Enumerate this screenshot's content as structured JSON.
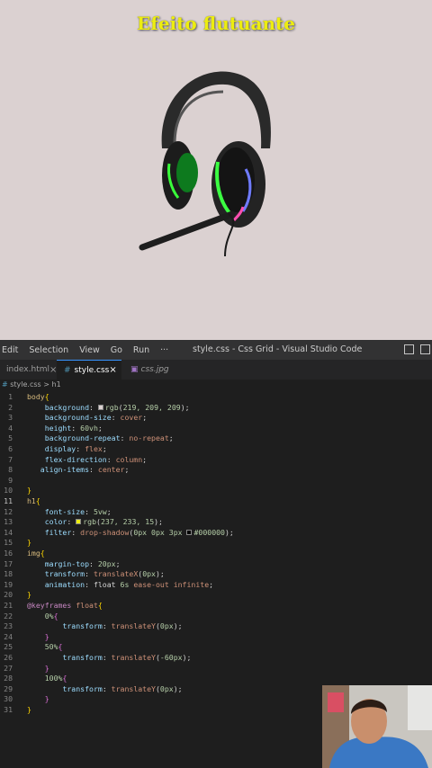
{
  "preview": {
    "title": "Efeito flutuante",
    "background": "#dbd1d1",
    "title_color": "#eded0f"
  },
  "titlebar": {
    "menu": [
      "Edit",
      "Selection",
      "View",
      "Go",
      "Run",
      "···"
    ],
    "window_title": "style.css - Css Grid - Visual Studio Code"
  },
  "tabs": [
    {
      "label": "index.html",
      "close": "×",
      "active": false
    },
    {
      "label": "style.css",
      "close": "×",
      "active": true,
      "icon": "#"
    },
    {
      "label": "css.jpg",
      "active": false
    }
  ],
  "breadcrumb": {
    "file": "style.css",
    "separator": ">",
    "symbol": "h1"
  },
  "code_lines": [
    {
      "n": "1",
      "html": "<span class='sel'>body</span><span class='br1'>{</span>"
    },
    {
      "n": "2",
      "html": "    <span class='prop'>background</span><span class='pun'>: </span><span class='swatch' style='background:#dbd1d1'></span><span class='num'>rgb</span><span class='pun'>(</span><span class='num'>219, 209, 209</span><span class='pun'>);</span>"
    },
    {
      "n": "3",
      "html": "    <span class='prop'>background-size</span><span class='pun'>: </span><span class='val'>cover</span><span class='pun'>;</span>"
    },
    {
      "n": "4",
      "html": "    <span class='prop'>height</span><span class='pun'>: </span><span class='num'>60vh</span><span class='pun'>;</span>"
    },
    {
      "n": "5",
      "html": "    <span class='prop'>background-repeat</span><span class='pun'>: </span><span class='val'>no-repeat</span><span class='pun'>;</span>"
    },
    {
      "n": "6",
      "html": "    <span class='prop'>display</span><span class='pun'>: </span><span class='val'>flex</span><span class='pun'>;</span>"
    },
    {
      "n": "7",
      "html": "    <span class='prop'>flex-direction</span><span class='pun'>: </span><span class='val'>column</span><span class='pun'>;</span>"
    },
    {
      "n": "8",
      "html": "   <span class='prop'>align-items</span><span class='pun'>: </span><span class='val'>center</span><span class='pun'>;</span>"
    },
    {
      "n": "9",
      "html": ""
    },
    {
      "n": "10",
      "html": "<span class='br1'>}</span>"
    },
    {
      "n": "11",
      "html": "<span class='sel'>h1</span><span class='br1'>{</span>"
    },
    {
      "n": "12",
      "html": "    <span class='prop'>font-size</span><span class='pun'>: </span><span class='num'>5vw</span><span class='pun'>;</span>"
    },
    {
      "n": "13",
      "html": "    <span class='prop'>color</span><span class='pun'>: </span><span class='swatch' style='background:#eded0f'></span><span class='num'>rgb</span><span class='pun'>(</span><span class='num'>237, 233, 15</span><span class='pun'>);</span>"
    },
    {
      "n": "14",
      "html": "    <span class='prop'>filter</span><span class='pun'>: </span><span class='val'>drop-shadow</span><span class='pun'>(</span><span class='num'>0px 0px 3px </span><span class='swatch' style='background:#000'></span><span class='num'>#000000</span><span class='pun'>);</span>"
    },
    {
      "n": "15",
      "html": "<span class='br1'>}</span>"
    },
    {
      "n": "16",
      "html": "<span class='sel'>img</span><span class='br1'>{</span>"
    },
    {
      "n": "17",
      "html": "    <span class='prop'>margin-top</span><span class='pun'>: </span><span class='num'>20px</span><span class='pun'>;</span>"
    },
    {
      "n": "18",
      "html": "    <span class='prop'>transform</span><span class='pun'>: </span><span class='val'>translateX</span><span class='pun'>(</span><span class='num'>0px</span><span class='pun'>);</span>"
    },
    {
      "n": "19",
      "html": "    <span class='prop'>animation</span><span class='pun'>: </span><span class='kw'>float</span><span class='num'> 6s</span><span class='val'> ease-out infinite</span><span class='pun'>;</span>"
    },
    {
      "n": "20",
      "html": "<span class='br1'>}</span>"
    },
    {
      "n": "21",
      "html": "<span class='at'>@keyframes</span><span class='val'> float</span><span class='br1'>{</span>"
    },
    {
      "n": "22",
      "html": "    <span class='num'>0%</span><span class='br2'>{</span>"
    },
    {
      "n": "23",
      "html": "        <span class='prop'>transform</span><span class='pun'>: </span><span class='val'>translateY</span><span class='pun'>(</span><span class='num'>0px</span><span class='pun'>);</span>"
    },
    {
      "n": "24",
      "html": "    <span class='br2'>}</span>"
    },
    {
      "n": "25",
      "html": "    <span class='num'>50%</span><span class='br2'>{</span>"
    },
    {
      "n": "26",
      "html": "        <span class='prop'>transform</span><span class='pun'>: </span><span class='val'>translateY</span><span class='pun'>(</span><span class='num'>-60px</span><span class='pun'>);</span>"
    },
    {
      "n": "27",
      "html": "    <span class='br2'>}</span>"
    },
    {
      "n": "28",
      "html": "    <span class='num'>100%</span><span class='br2'>{</span>"
    },
    {
      "n": "29",
      "html": "        <span class='prop'>transform</span><span class='pun'>: </span><span class='val'>translateY</span><span class='pun'>(</span><span class='num'>0px</span><span class='pun'>);</span>"
    },
    {
      "n": "30",
      "html": "    <span class='br2'>}</span>"
    },
    {
      "n": "31",
      "html": "<span class='br1'>}</span>"
    }
  ],
  "colors": {
    "editor_bg": "#1e1e1e",
    "accent": "#3794ff"
  },
  "webcam": {
    "description_icon": "webcam-person"
  }
}
